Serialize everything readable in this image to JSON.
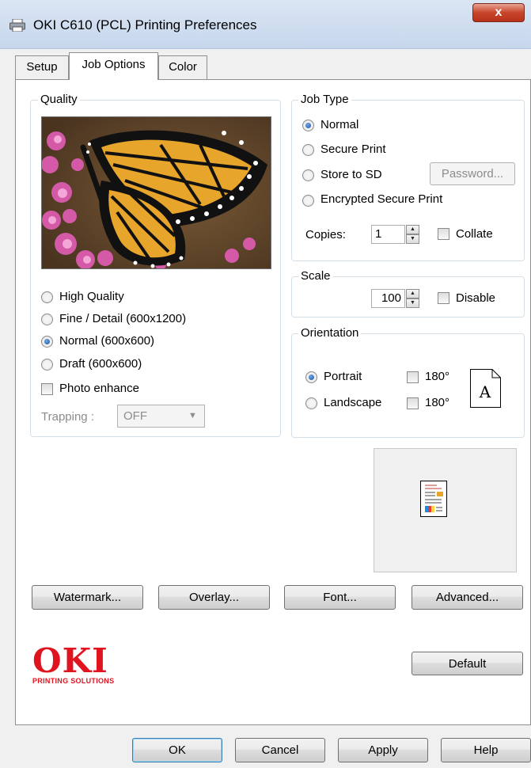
{
  "window": {
    "title": "OKI C610 (PCL) Printing Preferences",
    "close_glyph": "x"
  },
  "tabs": [
    {
      "label": "Setup",
      "active": false
    },
    {
      "label": "Job Options",
      "active": true
    },
    {
      "label": "Color",
      "active": false
    }
  ],
  "quality": {
    "group_label": "Quality",
    "options": [
      {
        "label": "High Quality",
        "checked": false
      },
      {
        "label": "Fine / Detail (600x1200)",
        "checked": false
      },
      {
        "label": "Normal (600x600)",
        "checked": true
      },
      {
        "label": "Draft (600x600)",
        "checked": false
      }
    ],
    "photo_enhance_label": "Photo enhance",
    "photo_enhance_checked": false,
    "trapping_label": "Trapping :",
    "trapping_value": "OFF"
  },
  "job_type": {
    "group_label": "Job Type",
    "options": [
      {
        "label": "Normal",
        "checked": true
      },
      {
        "label": "Secure Print",
        "checked": false
      },
      {
        "label": "Store to SD",
        "checked": false
      },
      {
        "label": "Encrypted Secure Print",
        "checked": false
      }
    ],
    "password_button": "Password...",
    "copies_label": "Copies:",
    "copies_value": "1",
    "collate_label": "Collate",
    "collate_checked": false
  },
  "scale": {
    "group_label": "Scale",
    "value": "100",
    "disable_label": "Disable",
    "disable_checked": false
  },
  "orientation": {
    "group_label": "Orientation",
    "portrait_label": "Portrait",
    "landscape_label": "Landscape",
    "selected": "Portrait",
    "rotate_label_1": "180°",
    "rotate_label_2": "180°",
    "icon_letter": "A"
  },
  "buttons": {
    "watermark": "Watermark...",
    "overlay": "Overlay...",
    "font": "Font...",
    "advanced": "Advanced...",
    "default": "Default",
    "ok": "OK",
    "cancel": "Cancel",
    "apply": "Apply",
    "help": "Help"
  },
  "logo": {
    "main": "OKI",
    "sub": "PRINTING SOLUTIONS"
  },
  "colors": {
    "brand_red": "#e0141e",
    "titlebar": "#c6d6ec",
    "close_button": "#c7452b"
  }
}
